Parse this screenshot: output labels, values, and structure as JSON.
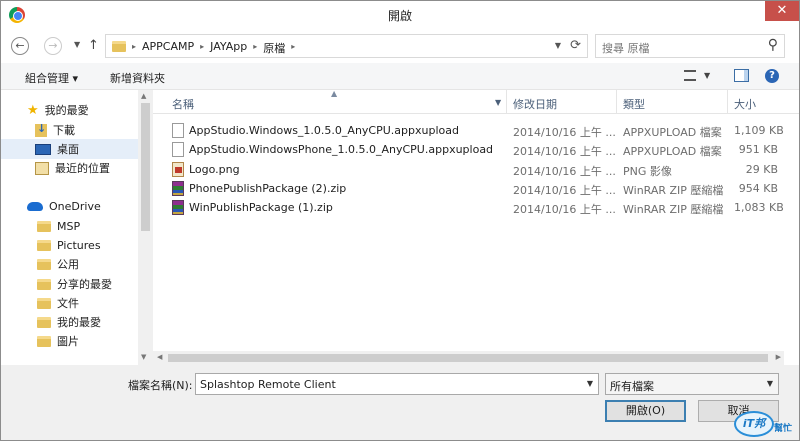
{
  "window": {
    "title": "開啟",
    "close_glyph": "✕"
  },
  "address": {
    "crumbs": [
      "APPCAMP",
      "JAYApp",
      "原檔"
    ],
    "separator": "▸",
    "search_placeholder": "搜尋 原檔"
  },
  "toolbar": {
    "organize": "組合管理 ▾",
    "new_folder": "新增資料夾"
  },
  "nav_pane": {
    "items": [
      {
        "label": "我的最愛",
        "icon": "star-icon"
      },
      {
        "label": "下載",
        "icon": "downloads-icon"
      },
      {
        "label": "桌面",
        "icon": "desktop-icon",
        "selected": true
      },
      {
        "label": "最近的位置",
        "icon": "recent-places-icon"
      },
      {
        "label": "OneDrive",
        "icon": "cloud-icon"
      },
      {
        "label": "MSP",
        "icon": "folder-icon"
      },
      {
        "label": "Pictures",
        "icon": "folder-icon"
      },
      {
        "label": "公用",
        "icon": "folder-icon"
      },
      {
        "label": "分享的最愛",
        "icon": "folder-icon"
      },
      {
        "label": "文件",
        "icon": "folder-icon"
      },
      {
        "label": "我的最愛",
        "icon": "folder-icon"
      },
      {
        "label": "圖片",
        "icon": "folder-icon"
      }
    ]
  },
  "columns": {
    "name": "名稱",
    "date": "修改日期",
    "type": "類型",
    "size": "大小"
  },
  "files": [
    {
      "name": "AppStudio.Windows_1.0.5.0_AnyCPU.appxupload",
      "date": "2014/10/16 上午 ...",
      "type": "APPXUPLOAD 檔案",
      "size": "1,109 KB",
      "icon": "document-icon"
    },
    {
      "name": "AppStudio.WindowsPhone_1.0.5.0_AnyCPU.appxupload",
      "date": "2014/10/16 上午 ...",
      "type": "APPXUPLOAD 檔案",
      "size": "951 KB",
      "icon": "document-icon"
    },
    {
      "name": "Logo.png",
      "date": "2014/10/16 上午 ...",
      "type": "PNG 影像",
      "size": "29 KB",
      "icon": "png-image-icon"
    },
    {
      "name": "PhonePublishPackage (2).zip",
      "date": "2014/10/16 上午 ...",
      "type": "WinRAR ZIP 壓縮檔",
      "size": "954 KB",
      "icon": "winrar-archive-icon"
    },
    {
      "name": "WinPublishPackage (1).zip",
      "date": "2014/10/16 上午 ...",
      "type": "WinRAR ZIP 壓縮檔",
      "size": "1,083 KB",
      "icon": "winrar-archive-icon"
    }
  ],
  "footer": {
    "filename_label": "檔案名稱(N):",
    "filename_value": "Splashtop Remote Client",
    "filetype_value": "所有檔案",
    "open_label": "開啟(O)",
    "cancel_label": "取消"
  },
  "watermark": {
    "logo": "iT邦",
    "sub": "幫忙"
  }
}
